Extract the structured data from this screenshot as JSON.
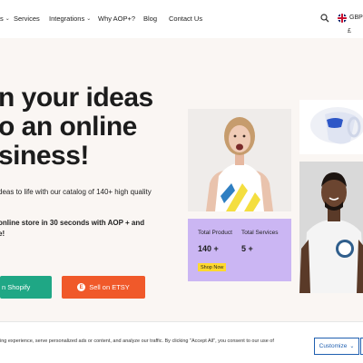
{
  "nav": {
    "items": [
      {
        "label": "s",
        "has_dropdown": true
      },
      {
        "label": "Services",
        "has_dropdown": false
      },
      {
        "label": "Integrations",
        "has_dropdown": true
      },
      {
        "label": "Why AOP+?",
        "has_dropdown": false
      },
      {
        "label": "Blog",
        "has_dropdown": false
      },
      {
        "label": "Contact Us",
        "has_dropdown": false
      }
    ],
    "currency": "GBP",
    "currency_symbol": "£"
  },
  "hero": {
    "heading_lines": [
      "n your ideas",
      "o an online",
      "siness!"
    ],
    "copy": "deas to life with our catalog of 140+ high quality",
    "copy2_line1": "online store in 30 seconds with AOP + and",
    "copy2_line2": "e!",
    "btn_shopify": "n Shopify",
    "btn_etsy": "Sell on ETSY",
    "etsy_badge": "E"
  },
  "stats": {
    "total_product_label": "Total Product",
    "total_product_value": "140 +",
    "total_services_label": "Total Services",
    "total_services_value": "5 +",
    "shop_now": "Shop Now"
  },
  "cookie": {
    "text": "ing experience, serve personalized ads or content, and analyze our traffic. By clicking \"Accept All\", you consent to our use of",
    "customize": "Customize"
  },
  "colors": {
    "background": "#faf6f3",
    "shopify_green": "#1fa785",
    "etsy_orange": "#f0592a",
    "stats_purple": "#cbb6f3",
    "shop_now_yellow": "#ffd92e",
    "customize_blue": "#1f5fb0"
  }
}
